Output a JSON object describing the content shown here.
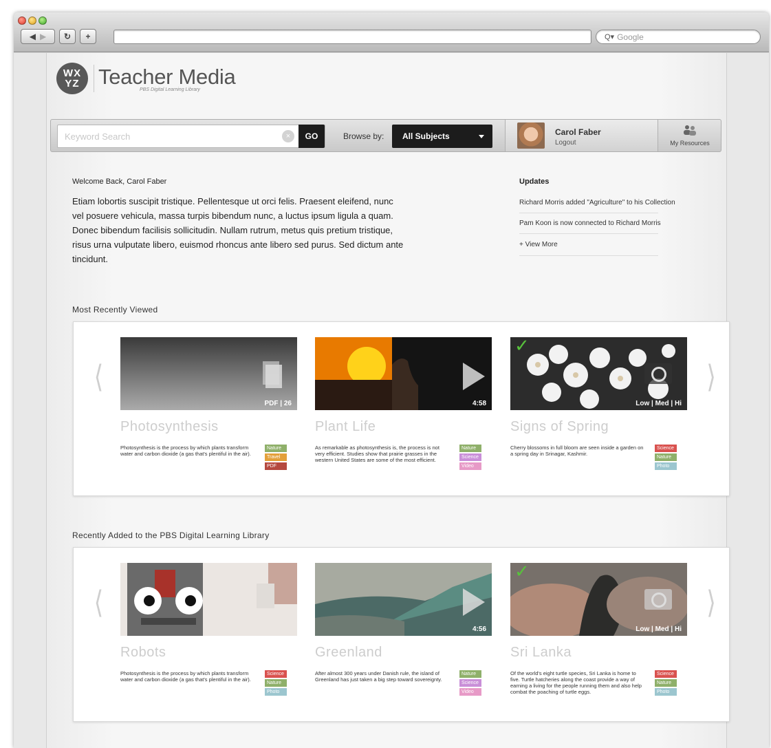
{
  "browser": {
    "search_placeholder": "Google"
  },
  "site": {
    "logo_lines": [
      "WX",
      "YZ"
    ],
    "title": "Teacher Media",
    "subtitle": "PBS Digital Learning Library"
  },
  "toolbar": {
    "search_placeholder": "Keyword Search",
    "go_label": "GO",
    "browse_label": "Browse by:",
    "subject_selected": "All Subjects",
    "user_name": "Carol Faber",
    "logout_label": "Logout",
    "resources_label": "My Resources"
  },
  "welcome": {
    "title": "Welcome Back, Carol Faber",
    "body": "Etiam lobortis suscipit tristique. Pellentesque ut orci felis. Praesent eleifend, nunc vel posuere vehicula, massa turpis bibendum nunc, a luctus ipsum ligula a quam. Donec bibendum facilisis sollicitudin. Nullam rutrum, metus quis pretium tristique, risus urna vulputate libero, euismod rhoncus ante libero sed purus. Sed dictum ante tincidunt."
  },
  "updates": {
    "title": "Updates",
    "items": [
      "Richard Morris added \"Agriculture\" to his Collection",
      "Pam Koon is now connected to Richard Morris"
    ],
    "view_more": "+ View More"
  },
  "recent": {
    "title": "Most Recently Viewed",
    "cards": [
      {
        "title": "Photosynthesis",
        "caption": "PDF | 26",
        "desc": "Photosynthesis is the process by which plants transform water and carbon dioxide (a gas that's plentiful in the air).",
        "tags": [
          "Nature",
          "Travel",
          "PDF"
        ]
      },
      {
        "title": "Plant Life",
        "caption": "4:58",
        "desc": "As remarkable as photosynthesis is, the process is not very efficient. Studies show that prairie grasses in the western United States are some of the most efficient.",
        "tags": [
          "Nature",
          "Science",
          "Video"
        ]
      },
      {
        "title": "Signs of Spring",
        "caption": "Low | Med | Hi",
        "desc": "Cherry blossoms in full bloom are seen inside a garden on a spring day in Srinagar, Kashmir.",
        "tags": [
          "Science",
          "Nature",
          "Photo"
        ]
      }
    ]
  },
  "added": {
    "title": "Recently Added to the PBS Digital Learning Library",
    "cards": [
      {
        "title": "Robots",
        "caption": "",
        "desc": "Photosynthesis is the process by which plants transform water and carbon dioxide (a gas that's plentiful in the air).",
        "tags": [
          "Science",
          "Nature",
          "Photo"
        ]
      },
      {
        "title": "Greenland",
        "caption": "4:56",
        "desc": "After almost 300 years under Danish rule, the island of Greenland has just taken a big step toward sovereignty.",
        "tags": [
          "Nature",
          "Science",
          "Video"
        ]
      },
      {
        "title": "Sri Lanka",
        "caption": "Low | Med | Hi",
        "desc": "Of the world's eight turtle species, Sri Lanka is home to five. Turtle hatcheries along the coast provide a way of earning a living for the people running them and also help combat the poaching of turtle eggs.",
        "tags": [
          "Science",
          "Nature",
          "Photo"
        ]
      }
    ]
  },
  "colors": {
    "tag_nature": "#8fb06a",
    "tag_travel": "#e3a03a",
    "tag_pdf": "#b5493f",
    "tag_science": "#d9524f",
    "tag_video": "#e79ac7",
    "tag_photo": "#9cc6cf",
    "tag_science_purple": "#c98fd8"
  }
}
